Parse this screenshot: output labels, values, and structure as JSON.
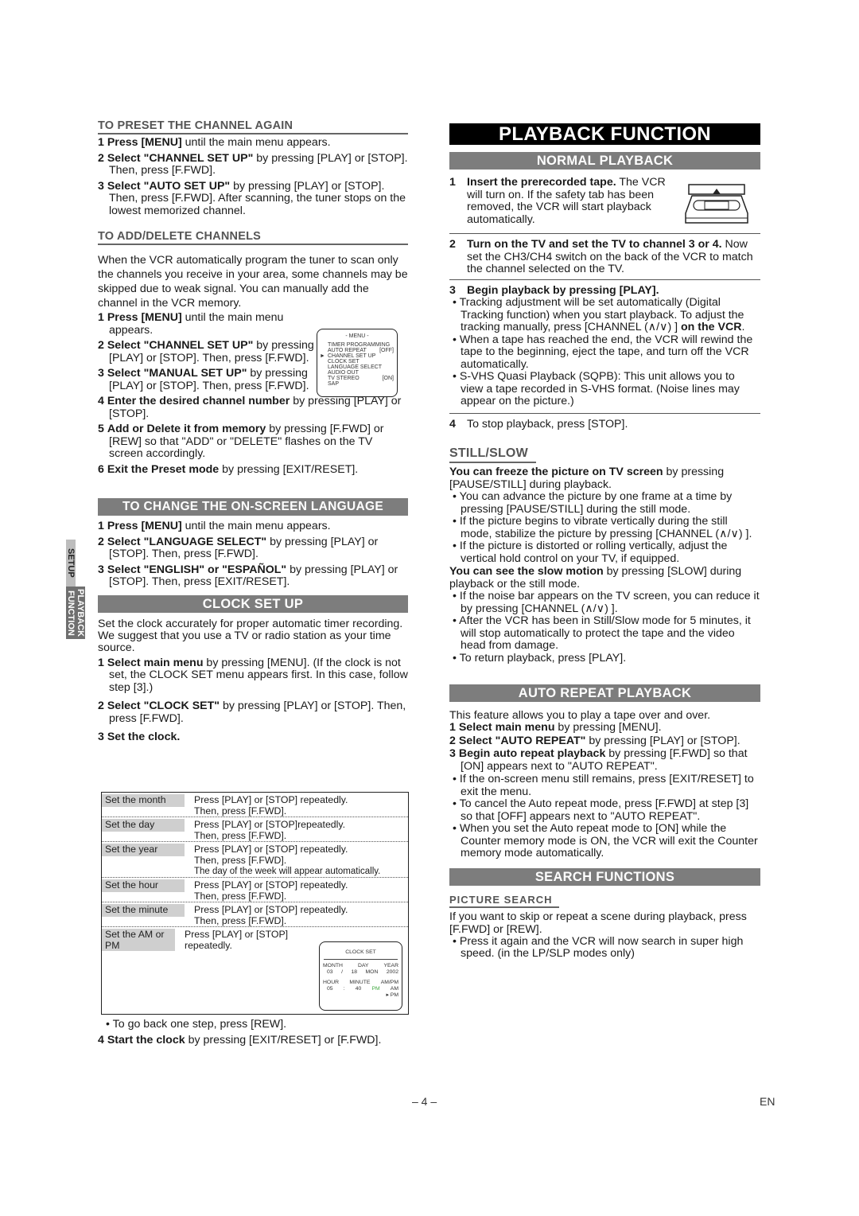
{
  "side_tab": {
    "top": "SETUP",
    "bottom": "PLAYBACK FUNCTION"
  },
  "left": {
    "preset_again": {
      "heading": "TO PRESET THE CHANNEL AGAIN",
      "steps": [
        {
          "num": "1",
          "bold": "Press [MENU]",
          "text": " until the main menu appears."
        },
        {
          "num": "2",
          "bold": "Select \"CHANNEL SET UP\"",
          "text": " by pressing [PLAY] or [STOP]. Then, press [F.FWD]."
        },
        {
          "num": "3",
          "bold": "Select \"AUTO SET UP\"",
          "text": " by pressing [PLAY] or [STOP]. Then, press [F.FWD]. After scanning, the tuner stops on the lowest memorized channel."
        }
      ]
    },
    "add_delete": {
      "heading": "TO ADD/DELETE CHANNELS",
      "intro": "When the VCR automatically program the tuner to scan only the channels you receive in your area, some channels may be skipped due to weak signal. You can manually add the channel in the VCR memory.",
      "steps": [
        {
          "num": "1",
          "bold": "Press [MENU]",
          "text": " until the main menu appears."
        },
        {
          "num": "2",
          "bold": "Select \"CHANNEL SET UP\"",
          "text": " by pressing [PLAY] or [STOP]. Then, press [F.FWD]."
        },
        {
          "num": "3",
          "bold": "Select \"MANUAL SET UP\"",
          "text": " by pressing [PLAY] or  [STOP]. Then, press [F.FWD]."
        },
        {
          "num": "4",
          "bold": "Enter the desired channel number",
          "text": " by pressing [PLAY] or [STOP]."
        },
        {
          "num": "5",
          "bold": "Add or Delete it from memory",
          "text": " by pressing [F.FWD] or [REW] so that \"ADD\" or \"DELETE\" flashes on the TV screen accordingly."
        },
        {
          "num": "6",
          "bold": "Exit the Preset mode",
          "text": " by pressing [EXIT/RESET]."
        }
      ],
      "menu_screen": {
        "title": "- MENU -",
        "items": [
          {
            "label": "TIMER PROGRAMMING",
            "value": ""
          },
          {
            "label": "AUTO REPEAT",
            "value": "[OFF]"
          },
          {
            "label": "CHANNEL SET UP",
            "value": "",
            "selected": true
          },
          {
            "label": "CLOCK SET",
            "value": ""
          },
          {
            "label": "LANGUAGE SELECT",
            "value": ""
          },
          {
            "label": "AUDIO OUT",
            "value": ""
          },
          {
            "label": "TV STEREO",
            "value": "[ON]"
          },
          {
            "label": "SAP",
            "value": ""
          }
        ]
      }
    },
    "language": {
      "heading": "TO CHANGE THE ON-SCREEN LANGUAGE",
      "steps": [
        {
          "num": "1",
          "bold": "Press [MENU]",
          "text": " until the main menu appears."
        },
        {
          "num": "2",
          "bold": "Select \"LANGUAGE SELECT\"",
          "text": " by pressing [PLAY] or [STOP]. Then, press [F.FWD]."
        },
        {
          "num": "3",
          "bold": "Select \"ENGLISH\" or \"ESPAÑOL\"",
          "text": " by pressing [PLAY] or  [STOP]. Then, press [EXIT/RESET]."
        }
      ]
    },
    "clock": {
      "heading": "CLOCK SET UP",
      "intro": "Set the clock accurately for proper automatic timer recording. We suggest that you use a TV or radio station as your time source.",
      "steps": [
        {
          "num": "1",
          "bold": "Select main menu",
          "text": " by pressing [MENU]. (If the clock is not set, the CLOCK SET menu appears first. In this case, follow step [3].)"
        },
        {
          "num": "2",
          "bold": "Select \"CLOCK SET\"",
          "text": " by pressing [PLAY] or [STOP]. Then, press [F.FWD]."
        },
        {
          "num": "3",
          "bold": "Set the clock.",
          "text": ""
        }
      ],
      "table": [
        {
          "label": "Set the month",
          "desc": [
            "Press [PLAY] or [STOP] repeatedly.",
            "Then, press [F.FWD]."
          ]
        },
        {
          "label": "Set the day",
          "desc": [
            "Press [PLAY] or [STOP]repeatedly.",
            "Then, press [F.FWD]."
          ]
        },
        {
          "label": "Set the year",
          "desc": [
            "Press [PLAY] or [STOP] repeatedly.",
            "Then, press [F.FWD].",
            "The day of the week will appear automatically."
          ]
        },
        {
          "label": "Set the hour",
          "desc": [
            "Press [PLAY] or [STOP] repeatedly.",
            "Then, press [F.FWD]."
          ]
        },
        {
          "label": "Set the minute",
          "desc": [
            "Press [PLAY] or [STOP] repeatedly.",
            "Then, press [F.FWD]."
          ]
        },
        {
          "label": "Set the AM or PM",
          "desc": [
            "Press [PLAY] or [STOP]",
            "repeatedly."
          ]
        }
      ],
      "clock_screen": {
        "title": "CLOCK SET",
        "month_label": "MONTH",
        "day_label": "DAY",
        "year_label": "YEAR",
        "month": "03",
        "day": "18",
        "weekday": "MON",
        "year": "2002",
        "hour_label": "HOUR",
        "minute_label": "MINUTE",
        "ampm_label": "AM/PM",
        "hour": "05",
        "minute": "40",
        "ampm": "PM",
        "opt_am": "AM",
        "opt_pm": "PM"
      },
      "back_note": "To go back one step, press [REW].",
      "step4": {
        "num": "4",
        "bold": "Start the clock",
        "text": " by pressing [EXIT/RESET] or [F.FWD]."
      }
    }
  },
  "right": {
    "title": "PLAYBACK FUNCTION",
    "normal": {
      "heading": "NORMAL PLAYBACK",
      "step1": {
        "num": "1",
        "bold": "Insert the prerecorded tape.",
        "text": " The VCR will turn on. If the safety tab has been removed, the VCR will start playback automatically."
      },
      "step2": {
        "num": "2",
        "bold": "Turn on the TV and set the TV to channel 3 or 4.",
        "text": " Now set the CH3/CH4 switch on the back of the VCR to match the channel selected on the TV."
      },
      "step3": {
        "num": "3",
        "bold": "Begin playback by pressing [PLAY].",
        "text": ""
      },
      "bullets": [
        {
          "text": "Tracking adjustment will be set automatically (Digital Tracking function) when you start playback. To adjust the tracking manually, press [CHANNEL (∧/∨) ]",
          "bold": " on the VCR",
          "tail": "."
        },
        {
          "text": "When a tape has reached the end, the VCR will rewind the tape to the beginning, eject the tape, and turn off the VCR automatically.",
          "bold": "",
          "tail": ""
        },
        {
          "text": "S-VHS Quasi Playback (SQPB): This unit allows you to view a tape recorded in S-VHS format. (Noise lines may appear on the picture.)",
          "bold": "",
          "tail": ""
        }
      ],
      "step4": {
        "num": "4",
        "text": "To stop playback, press [STOP]."
      }
    },
    "still": {
      "heading": "STILL/SLOW",
      "p1_bold": "You can freeze the picture on TV screen",
      "p1_text": " by pressing [PAUSE/STILL] during playback.",
      "bullets1": [
        "You can advance the picture by one frame at a time by pressing [PAUSE/STILL] during the still mode.",
        "If the picture begins to vibrate vertically during the still mode, stabilize the picture by pressing [CHANNEL (∧/∨) ].",
        "If the picture is distorted or rolling vertically, adjust the vertical hold control on your TV, if equipped."
      ],
      "p2_bold": "You can see the slow motion",
      "p2_text": " by pressing [SLOW] during playback or the still mode.",
      "bullets2": [
        "If the noise bar appears on the TV screen, you can reduce it by pressing [CHANNEL (∧/∨) ].",
        "After the VCR has been in Still/Slow mode for 5 minutes, it will stop automatically to protect the tape and the video head from damage.",
        "To return playback, press [PLAY]."
      ]
    },
    "auto_repeat": {
      "heading": "AUTO REPEAT PLAYBACK",
      "intro": "This feature allows you to play a tape over and over.",
      "steps": [
        {
          "num": "1",
          "bold": "Select main menu",
          "text": " by pressing [MENU]."
        },
        {
          "num": "2",
          "bold": "Select \"AUTO REPEAT\"",
          "text": " by pressing [PLAY] or [STOP]."
        },
        {
          "num": "3",
          "bold": "Begin auto repeat playback",
          "text": " by pressing [F.FWD] so that [ON] appears next to \"AUTO REPEAT\"."
        }
      ],
      "bullets": [
        "If the on-screen menu still remains, press [EXIT/RESET] to exit the menu.",
        "To cancel the Auto repeat mode, press [F.FWD] at step [3] so that [OFF] appears next to \"AUTO REPEAT\".",
        "When you set the Auto repeat mode to [ON] while the Counter memory mode is ON, the VCR will exit the Counter memory mode automatically."
      ]
    },
    "search": {
      "heading": "SEARCH FUNCTIONS",
      "sub": "PICTURE SEARCH",
      "intro": "If you want to skip or repeat a scene during playback, press [F.FWD] or [REW].",
      "bullets": [
        "Press it again and the VCR will now search in super high speed. (in the LP/SLP modes only)"
      ]
    }
  },
  "footer": {
    "page": "– 4 –",
    "lang": "EN"
  }
}
